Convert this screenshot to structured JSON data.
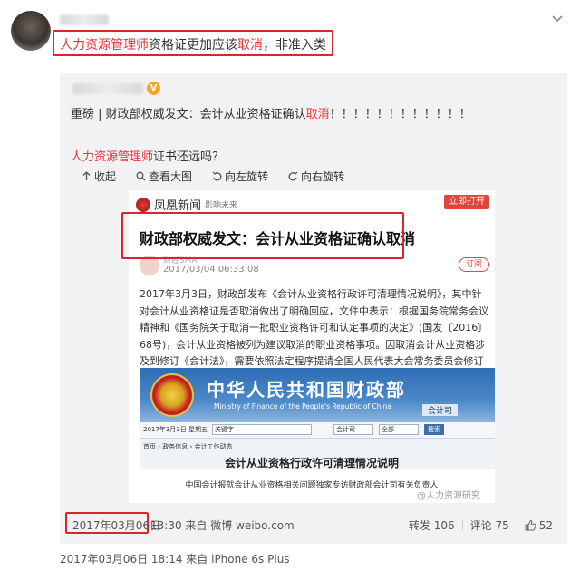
{
  "header": {
    "title_parts": {
      "red": "人力资源管理师",
      "mid1": "资格证更加应该",
      "red2": "取消",
      "tail": "，非准入类"
    }
  },
  "repost": {
    "badge": "V",
    "line1": {
      "lead": "重磅 | 财政部权威发文：会计从业资格证确认",
      "red": "取消",
      "tail": "！！！！！！！！！！！！"
    },
    "line2": {
      "red": "人力资源管理师",
      "tail": "证书还远吗？"
    },
    "toolbar": {
      "collapse": "收起",
      "view_large": "查看大图",
      "rotate_left": "向左旋转",
      "rotate_right": "向右旋转"
    },
    "card": {
      "site_name": "凤凰新闻",
      "site_sub": "影响未来",
      "open_button": "立即打开",
      "title": "财政部权威发文：会计从业资格证确认取消",
      "author": "财经SMA",
      "date": "2017/03/04 06:33:08",
      "follow": "订阅",
      "article": "2017年3月3日，财政部发布《会计从业资格行政许可清理情况说明》，其中针对会计从业资格证是否取消做出了明确回应，文件中表示：根据国务院常务会议精神和《国务院关于取消一批职业资格许可和认定事项的决定》(国发〔2016〕68号)，会计从业资格被列为建议取消的职业资格事项。因取消会计从业资格涉及到修订《会计法》，需要依照法定程序提请全国人民代表大会常务委员会修订相关法律规定。",
      "ministry_cn": "中华人民共和国财政部",
      "ministry_en": "Ministry of Finance of the People's Republic of China",
      "dept": "会计司",
      "nav_date": "2017年3月3日 星期五",
      "nav_input": "关键字",
      "nav_select": "会计司",
      "nav_select2": "全部",
      "nav_btn": "搜索",
      "crumb": "首页 › 政务信息 › 会计工作动态",
      "doc_title": "会计从业资格行政许可清理情况说明",
      "doc_sub": "中国会计报就会计从业资格相关问题独家专访财政部会计司有关负责人",
      "wm_small": "@人力资源研究"
    },
    "date": "2017年03月06日",
    "meta": "13:30 来自 微博 weibo.com",
    "repost_count": "转发 106",
    "comment_count": "评论 75",
    "like_count": "52"
  },
  "post": {
    "meta": "2017年03月06日 18:14 来自 iPhone 6s Plus"
  },
  "colors": {
    "accent_red": "#e8353a",
    "box_red": "#d9262b",
    "weibo_gold": "#f5a623"
  }
}
